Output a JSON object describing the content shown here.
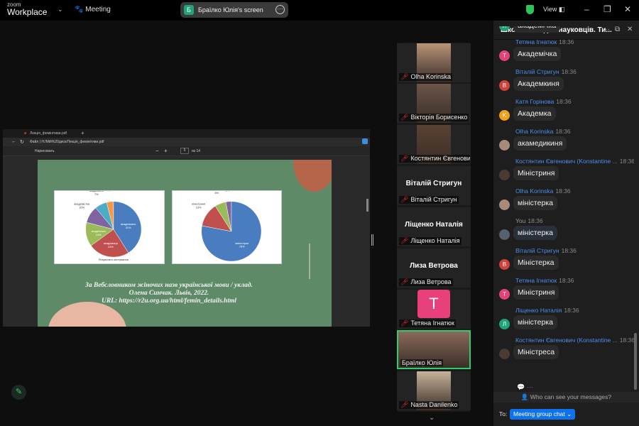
{
  "topbar": {
    "logo_small": "zoom",
    "logo_big": "Workplace",
    "meeting_label": "Meeting",
    "screen_avatar": "Б",
    "screen_title": "Браїлко Юлія's screen",
    "view_label": "View"
  },
  "browser": {
    "tab_title": "Лекція_фемінітиви.pdf",
    "address": "Файл | H:/Мій%20диск/Лекція_фемінітиви.pdf",
    "draw_label": "Нарисовать",
    "page_num": "5",
    "page_total": "из 14"
  },
  "slide": {
    "citation_line1": "За Вебсловником жіночих назв української мови /  уклад.",
    "citation_line2": "Олена Синчак. Львів, 2022.",
    "citation_line3": "URL: https://r2u.org.ua/html/femin_details.html"
  },
  "chart_data": [
    {
      "type": "pie",
      "title": "Результати опитування",
      "colors": [
        "#4a7cc0",
        "#c0504d",
        "#9bbb59",
        "#8064a2",
        "#4bacc6",
        "#f79646"
      ],
      "slices": [
        {
          "label": "академкиня",
          "value": 41
        },
        {
          "label": "академиця",
          "value": 24
        },
        {
          "label": "академічка",
          "value": 14
        },
        {
          "label": "академістка",
          "value": 10
        },
        {
          "label": "академиня",
          "value": 7
        },
        {
          "label": "академічиха",
          "value": 4
        }
      ]
    },
    {
      "type": "pie",
      "colors": [
        "#4a7cc0",
        "#c0504d",
        "#9bbb59",
        "#8064a2"
      ],
      "slices": [
        {
          "label": "міністерка",
          "value": 78
        },
        {
          "label": "міністриня",
          "value": 13
        },
        {
          "label": "жінка-міністр",
          "value": 6
        },
        {
          "label": "міністреса",
          "value": 3
        }
      ]
    }
  ],
  "participants": [
    {
      "name": "Olha Korinska",
      "video": true,
      "color": "#b89478"
    },
    {
      "name": "Вікторія Борисенко",
      "video": true,
      "color": "#6b5448"
    },
    {
      "name": "Костянтин Євгенови...",
      "video": true,
      "color": "#5a4232"
    },
    {
      "name": "Віталій Стригун",
      "big": "Віталій Стригун"
    },
    {
      "name": "Ліщенко Наталія",
      "big": "Ліщенко Наталія"
    },
    {
      "name": "Лиза Ветрова",
      "big": "Лиза Ветрова"
    },
    {
      "name": "Тетяна Ігнатюк",
      "initial": "T",
      "color": "#e8407a"
    },
    {
      "name": "Браїлко Юлія",
      "video": true,
      "color": "#8a6a5a",
      "active": true
    },
    {
      "name": "Nasta Danilenko",
      "video": true,
      "color": "#c7b39a"
    }
  ],
  "chat": {
    "title": "Школа молодих науковців. Ти...",
    "messages": [
      {
        "name": "",
        "time": "",
        "text": "академічка",
        "avatar": "Л",
        "color": "#1fa37a"
      },
      {
        "name": "Тетяна Ігнатюк",
        "time": "18:36",
        "text": "Академічка",
        "avatar": "T",
        "color": "#e8407a"
      },
      {
        "name": "Віталій Стригун",
        "time": "18:36",
        "text": "Академкиня",
        "avatar": "B",
        "color": "#d0423a"
      },
      {
        "name": "Катя Горінова",
        "time": "18:36",
        "text": "Академка",
        "avatar": "K",
        "color": "#f2a019"
      },
      {
        "name": "Olha Korinska",
        "time": "18:36",
        "text": "акамедикиня",
        "avatar": "",
        "color": "#a8897a"
      },
      {
        "name": "Костянтин Євгенович (Konstantine ...",
        "time": "18:36",
        "text": "Міністриня",
        "avatar": "",
        "color": "#4a3a32"
      },
      {
        "name": "Olha Korinska",
        "time": "18:36",
        "text": "міністерка",
        "avatar": "",
        "color": "#a8897a"
      },
      {
        "name": "You",
        "time": "18:36",
        "text": "міністерка",
        "avatar": "",
        "color": "#556070",
        "you": true
      },
      {
        "name": "Віталій Стригун",
        "time": "18:36",
        "text": "Міністерка",
        "avatar": "B",
        "color": "#d0423a"
      },
      {
        "name": "Тетяна Ігнатюк",
        "time": "18:36",
        "text": "Міністриня",
        "avatar": "T",
        "color": "#e8407a"
      },
      {
        "name": "Ліщенко Наталія",
        "time": "18:36",
        "text": "міністерка",
        "avatar": "Л",
        "color": "#1fa37a"
      },
      {
        "name": "Костянтин Євгенович (Konstantine ...",
        "time": "18:36",
        "text": "Міністреса",
        "avatar": "",
        "color": "#4a3a32"
      }
    ],
    "who_can_see": "Who can see your messages?",
    "to_label": "To:",
    "recipient": "Meeting group chat"
  }
}
